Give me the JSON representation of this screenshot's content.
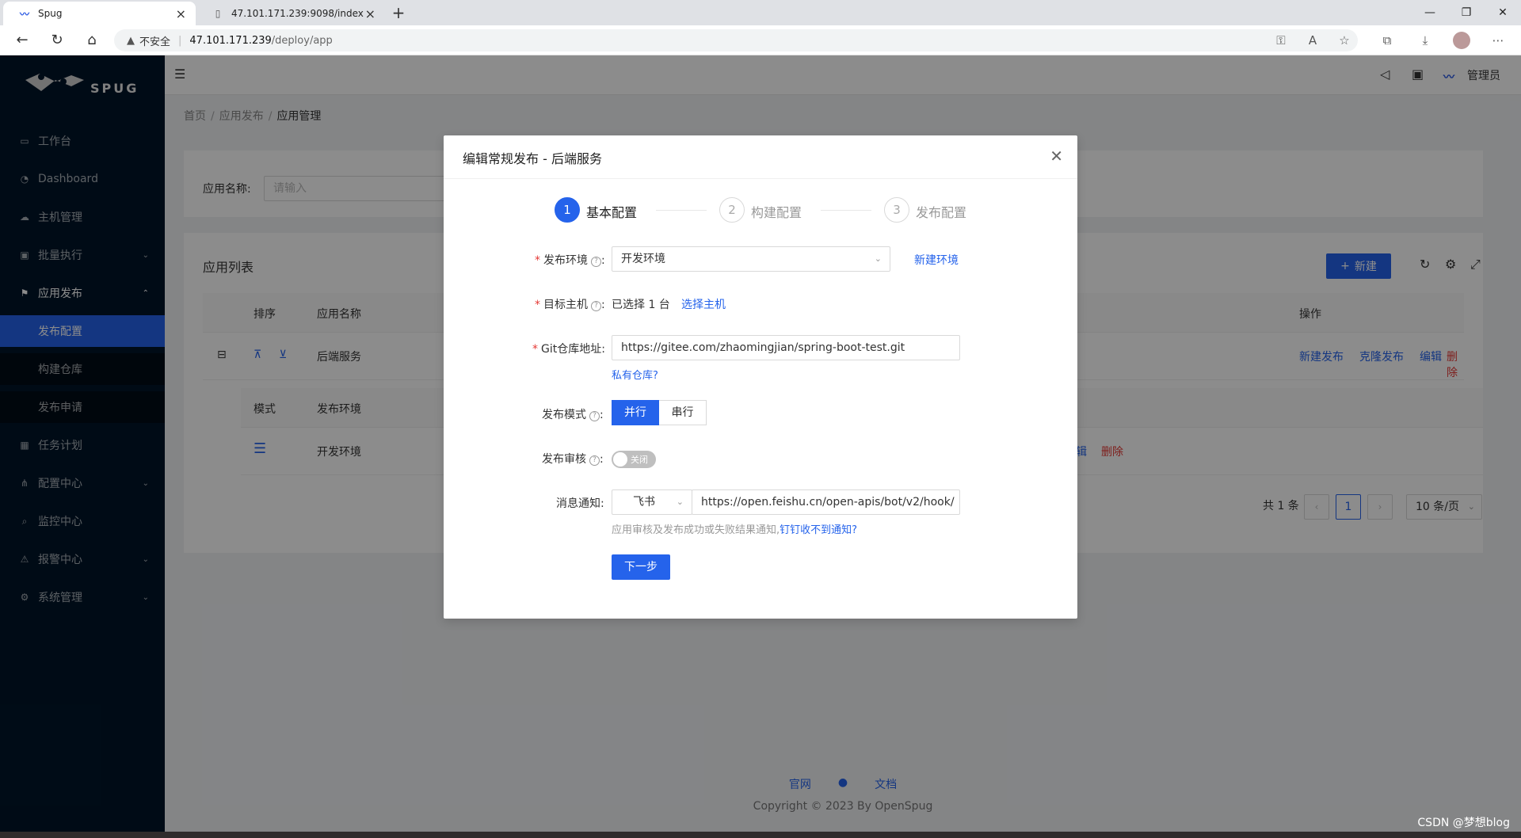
{
  "browser": {
    "tabs": [
      {
        "title": "Spug",
        "active": true
      },
      {
        "title": "47.101.171.239:9098/index",
        "active": false
      }
    ],
    "address": {
      "security_label": "不安全",
      "host": "47.101.171.239",
      "path": "/deploy/app"
    }
  },
  "sidebar": {
    "logo_text": "SPUG",
    "items": [
      {
        "label": "工作台",
        "icon": "desktop-icon"
      },
      {
        "label": "Dashboard",
        "icon": "dashboard-icon"
      },
      {
        "label": "主机管理",
        "icon": "cloud-icon"
      },
      {
        "label": "批量执行",
        "icon": "terminal-icon"
      },
      {
        "label": "应用发布",
        "icon": "flag-icon"
      },
      {
        "label": "任务计划",
        "icon": "schedule-icon"
      },
      {
        "label": "配置中心",
        "icon": "deployment-icon"
      },
      {
        "label": "监控中心",
        "icon": "monitor-icon"
      },
      {
        "label": "报警中心",
        "icon": "alert-icon"
      },
      {
        "label": "系统管理",
        "icon": "setting-icon"
      }
    ],
    "sub_items": [
      {
        "label": "发布配置",
        "selected": true
      },
      {
        "label": "构建仓库",
        "selected": false
      },
      {
        "label": "发布申请",
        "selected": false
      }
    ]
  },
  "header": {
    "user": "管理员"
  },
  "breadcrumb": [
    "首页",
    "应用发布",
    "应用管理"
  ],
  "search": {
    "label": "应用名称:",
    "placeholder": "请输入"
  },
  "app_list": {
    "title": "应用列表",
    "new_button": "新建",
    "columns": [
      "排序",
      "应用名称",
      "操作"
    ],
    "rows": [
      {
        "name": "后端服务",
        "actions": [
          "新建发布",
          "克隆发布",
          "编辑",
          "删除"
        ]
      }
    ],
    "sub_columns": [
      "模式",
      "发布环境"
    ],
    "sub_rows": [
      {
        "env": "开发环境",
        "actions": [
          "编辑",
          "删除"
        ]
      }
    ],
    "pagination": {
      "total": "共 1 条",
      "current_page": "1",
      "page_size": "10 条/页"
    }
  },
  "modal": {
    "title": "编辑常规发布 - 后端服务",
    "steps": [
      {
        "num": "1",
        "label": "基本配置",
        "status": "active"
      },
      {
        "num": "2",
        "label": "构建配置",
        "status": "wait"
      },
      {
        "num": "3",
        "label": "发布配置",
        "status": "wait"
      }
    ],
    "form": {
      "env_label": "发布环境",
      "env_value": "开发环境",
      "env_new_link": "新建环境",
      "host_label": "目标主机",
      "host_value": "已选择 1 台",
      "host_link": "选择主机",
      "git_label": "Git仓库地址:",
      "git_value": "https://gitee.com/zhaomingjian/spring-boot-test.git",
      "git_private_link": "私有仓库?",
      "mode_label": "发布模式",
      "mode_options": [
        "并行",
        "串行"
      ],
      "mode_selected": "并行",
      "audit_label": "发布审核",
      "audit_switch_text": "关闭",
      "notify_label": "消息通知:",
      "notify_type": "飞书",
      "notify_url": "https://open.feishu.cn/open-apis/bot/v2/hook/",
      "notify_hint": "应用审核及发布成功或失败结果通知,",
      "notify_hint_link": "钉钉收不到通知?",
      "next_button": "下一步"
    }
  },
  "footer": {
    "links": [
      "官网",
      "文档"
    ],
    "copyright": "Copyright © 2023 By OpenSpug"
  },
  "watermark": "CSDN @梦想blog",
  "colors": {
    "primary": "#2563eb",
    "sidebar_bg": "#001529",
    "danger": "#e53935"
  }
}
